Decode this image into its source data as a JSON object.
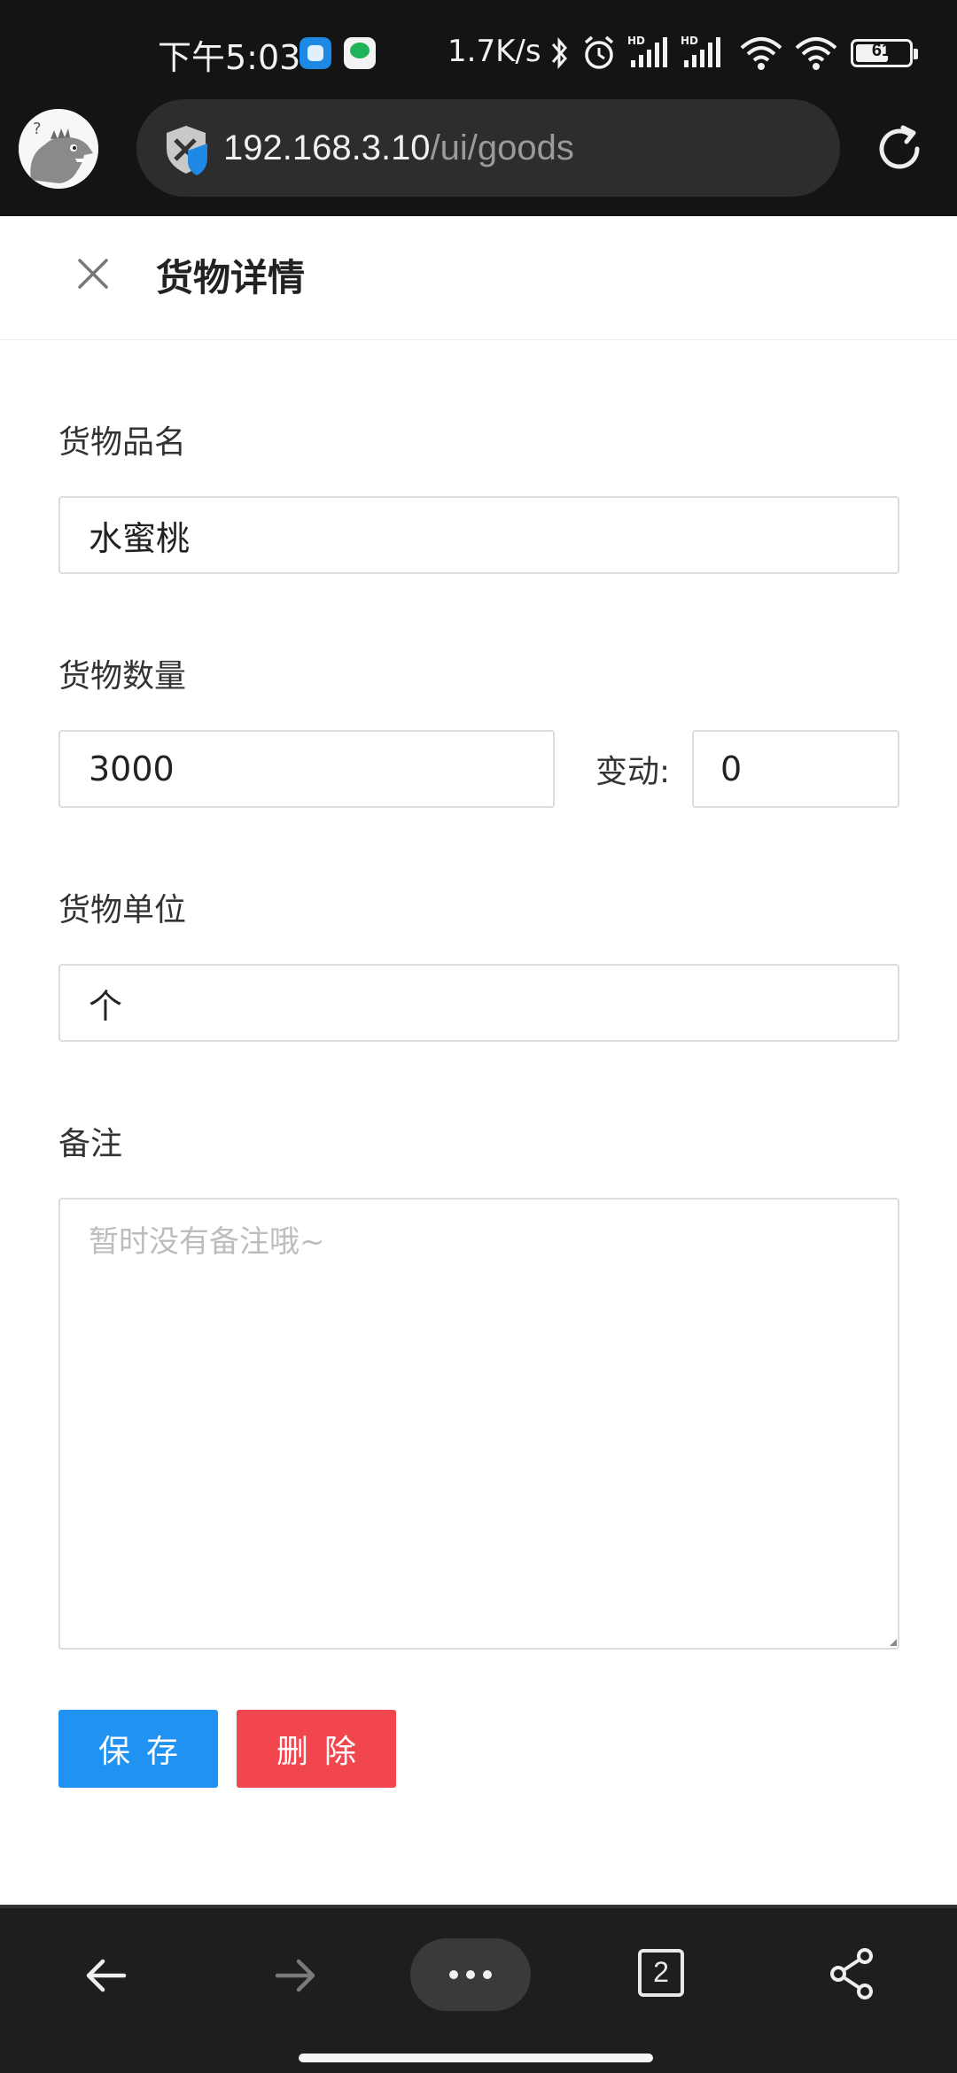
{
  "status_bar": {
    "time": "下午5:03",
    "net_speed": "1.7K/s",
    "battery": "61",
    "icons": [
      "app-notification-icon",
      "wechat-notification-icon",
      "bluetooth-icon",
      "alarm-icon",
      "signal-hd-icon",
      "signal-hd-icon",
      "wifi-icon",
      "wifi-icon",
      "battery-icon"
    ]
  },
  "browser": {
    "url_host": "192.168.3.10",
    "url_path": "/ui/goods",
    "tab_count": "2"
  },
  "page": {
    "title": "货物详情"
  },
  "form": {
    "name_label": "货物品名",
    "name_value": "水蜜桃",
    "quantity_label": "货物数量",
    "quantity_value": "3000",
    "change_label": "变动:",
    "change_value": "0",
    "unit_label": "货物单位",
    "unit_value": "个",
    "remark_label": "备注",
    "remark_value": "",
    "remark_placeholder": "暂时没有备注哦~"
  },
  "buttons": {
    "save": "保存",
    "delete": "删除"
  },
  "colors": {
    "primary": "#1f92f2",
    "danger": "#f2464f",
    "topbar": "#141414"
  }
}
